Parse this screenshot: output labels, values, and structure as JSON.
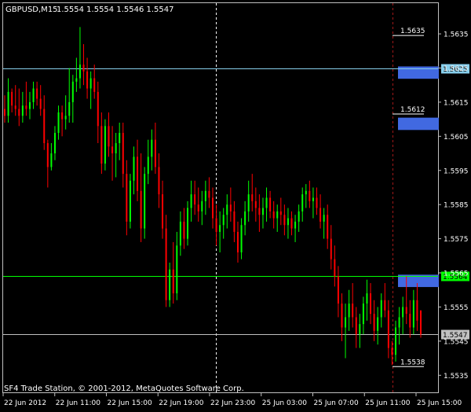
{
  "header": {
    "symbol_label": "GBPUSD,M15",
    "ohlc_label": "1.5554 1.5554 1.5546 1.5547"
  },
  "footer": {
    "copyright": "SF4 Trade Station, © 2001-2012, MetaQuotes Software Corp."
  },
  "chart_data": {
    "type": "candlestick",
    "symbol": "GBPUSD",
    "timeframe": "M15",
    "ohlc": {
      "open": 1.5554,
      "high": 1.5554,
      "low": 1.5546,
      "close": 1.5547
    },
    "ylim": [
      1.553,
      1.5644
    ],
    "y_ticks": [
      "1.5635",
      "1.5625",
      "1.5615",
      "1.5605",
      "1.5595",
      "1.5585",
      "1.5575",
      "1.5565",
      "1.5555",
      "1.5545",
      "1.5535"
    ],
    "x_ticks": [
      "22 Jun 2012",
      "22 Jun 11:00",
      "22 Jun 15:00",
      "22 Jun 19:00",
      "22 Jun 23:00",
      "25 Jun 03:00",
      "25 Jun 07:00",
      "25 Jun 11:00",
      "25 Jun 15:00"
    ],
    "horizontal_lines": [
      {
        "price": 1.5625,
        "label": "1.5625",
        "color": "#87CEEB"
      },
      {
        "price": 1.5564,
        "label": "1.5564",
        "color": "#00FF00"
      },
      {
        "price": 1.5547,
        "label": "1.5547",
        "color": "#C0C0C0"
      }
    ],
    "price_markers": [
      {
        "price": 1.5635,
        "label": "1.5635"
      },
      {
        "price": 1.5612,
        "label": "1.5612"
      },
      {
        "price": 1.5538,
        "label": "1.5538"
      }
    ],
    "zones": [
      {
        "top": 1.5625,
        "bottom": 1.5623
      },
      {
        "top": 1.561,
        "bottom": 1.5608
      },
      {
        "top": 1.5564,
        "bottom": 1.5562
      }
    ],
    "candles": [
      [
        1.5613,
        1.5617,
        1.5609,
        1.5611
      ],
      [
        1.5611,
        1.5622,
        1.5609,
        1.5618
      ],
      [
        1.5618,
        1.5619,
        1.5612,
        1.5614
      ],
      [
        1.5614,
        1.562,
        1.5611,
        1.5613
      ],
      [
        1.5613,
        1.5619,
        1.5608,
        1.5611
      ],
      [
        1.5611,
        1.5618,
        1.5609,
        1.5614
      ],
      [
        1.5614,
        1.5621,
        1.5611,
        1.5613
      ],
      [
        1.5613,
        1.5618,
        1.561,
        1.5615
      ],
      [
        1.5615,
        1.5621,
        1.5613,
        1.5619
      ],
      [
        1.5619,
        1.5621,
        1.5614,
        1.5616
      ],
      [
        1.5616,
        1.562,
        1.5611,
        1.5613
      ],
      [
        1.5613,
        1.5617,
        1.5601,
        1.5603
      ],
      [
        1.5603,
        1.5604,
        1.559,
        1.5596
      ],
      [
        1.5596,
        1.5603,
        1.5595,
        1.56
      ],
      [
        1.56,
        1.5608,
        1.5598,
        1.5606
      ],
      [
        1.5606,
        1.5614,
        1.5604,
        1.5612
      ],
      [
        1.5612,
        1.5614,
        1.5605,
        1.561
      ],
      [
        1.561,
        1.5617,
        1.5607,
        1.5611
      ],
      [
        1.5611,
        1.5625,
        1.5609,
        1.5615
      ],
      [
        1.5615,
        1.5623,
        1.5609,
        1.5621
      ],
      [
        1.5621,
        1.5628,
        1.5618,
        1.5622
      ],
      [
        1.5622,
        1.5637,
        1.5619,
        1.5626
      ],
      [
        1.5626,
        1.5632,
        1.562,
        1.5624
      ],
      [
        1.5624,
        1.5628,
        1.5616,
        1.5619
      ],
      [
        1.5619,
        1.5624,
        1.5613,
        1.5622
      ],
      [
        1.5622,
        1.5626,
        1.5616,
        1.5618
      ],
      [
        1.5618,
        1.5621,
        1.5603,
        1.5608
      ],
      [
        1.5608,
        1.5612,
        1.5594,
        1.5597
      ],
      [
        1.5597,
        1.561,
        1.5595,
        1.5608
      ],
      [
        1.5608,
        1.5612,
        1.5599,
        1.5602
      ],
      [
        1.5602,
        1.5608,
        1.5592,
        1.56
      ],
      [
        1.56,
        1.5606,
        1.5593,
        1.5603
      ],
      [
        1.5603,
        1.5609,
        1.5598,
        1.5606
      ],
      [
        1.5606,
        1.5609,
        1.559,
        1.5594
      ],
      [
        1.5594,
        1.5598,
        1.5576,
        1.558
      ],
      [
        1.558,
        1.5594,
        1.5578,
        1.5592
      ],
      [
        1.5592,
        1.5602,
        1.5588,
        1.5599
      ],
      [
        1.5599,
        1.5604,
        1.5586,
        1.5589
      ],
      [
        1.5589,
        1.56,
        1.5574,
        1.5578
      ],
      [
        1.5578,
        1.5596,
        1.5575,
        1.5594
      ],
      [
        1.5594,
        1.5604,
        1.5591,
        1.5599
      ],
      [
        1.5599,
        1.5607,
        1.5595,
        1.5604
      ],
      [
        1.5604,
        1.5609,
        1.5594,
        1.5596
      ],
      [
        1.5596,
        1.56,
        1.5584,
        1.5588
      ],
      [
        1.5588,
        1.5592,
        1.5575,
        1.5578
      ],
      [
        1.5578,
        1.5582,
        1.5555,
        1.5557
      ],
      [
        1.5557,
        1.5568,
        1.5555,
        1.5566
      ],
      [
        1.5566,
        1.5574,
        1.5556,
        1.5559
      ],
      [
        1.5559,
        1.5577,
        1.5557,
        1.5573
      ],
      [
        1.5573,
        1.5583,
        1.557,
        1.558
      ],
      [
        1.558,
        1.5584,
        1.5572,
        1.5575
      ],
      [
        1.5575,
        1.5586,
        1.5573,
        1.5584
      ],
      [
        1.5584,
        1.5592,
        1.558,
        1.5588
      ],
      [
        1.5588,
        1.5592,
        1.5582,
        1.5585
      ],
      [
        1.5585,
        1.559,
        1.558,
        1.5583
      ],
      [
        1.5583,
        1.5589,
        1.5579,
        1.5586
      ],
      [
        1.5586,
        1.5592,
        1.5582,
        1.5589
      ],
      [
        1.5589,
        1.5593,
        1.5584,
        1.5587
      ],
      [
        1.5587,
        1.559,
        1.5578,
        1.5581
      ],
      [
        1.5581,
        1.5585,
        1.5573,
        1.5577
      ],
      [
        1.5577,
        1.5583,
        1.5571,
        1.5579
      ],
      [
        1.5579,
        1.5584,
        1.5575,
        1.5582
      ],
      [
        1.5582,
        1.5588,
        1.5578,
        1.5585
      ],
      [
        1.5585,
        1.559,
        1.558,
        1.5583
      ],
      [
        1.5583,
        1.5586,
        1.5574,
        1.5577
      ],
      [
        1.5577,
        1.558,
        1.5568,
        1.5571
      ],
      [
        1.5571,
        1.5581,
        1.5569,
        1.5579
      ],
      [
        1.5579,
        1.5586,
        1.5576,
        1.5583
      ],
      [
        1.5583,
        1.5592,
        1.558,
        1.5588
      ],
      [
        1.5588,
        1.5594,
        1.5583,
        1.5586
      ],
      [
        1.5586,
        1.559,
        1.558,
        1.5584
      ],
      [
        1.5584,
        1.5588,
        1.5577,
        1.5582
      ],
      [
        1.5582,
        1.5587,
        1.5578,
        1.5584
      ],
      [
        1.5584,
        1.559,
        1.558,
        1.5587
      ],
      [
        1.5587,
        1.5589,
        1.5581,
        1.5583
      ],
      [
        1.5583,
        1.5586,
        1.5578,
        1.5581
      ],
      [
        1.5581,
        1.5585,
        1.5577,
        1.5583
      ],
      [
        1.5583,
        1.5587,
        1.5579,
        1.5582
      ],
      [
        1.5582,
        1.5585,
        1.5576,
        1.5579
      ],
      [
        1.5579,
        1.5584,
        1.5575,
        1.5581
      ],
      [
        1.5581,
        1.5583,
        1.5576,
        1.5578
      ],
      [
        1.5578,
        1.5582,
        1.5574,
        1.558
      ],
      [
        1.558,
        1.5585,
        1.5577,
        1.5583
      ],
      [
        1.5583,
        1.559,
        1.558,
        1.5588
      ],
      [
        1.5588,
        1.5591,
        1.5584,
        1.5589
      ],
      [
        1.5589,
        1.5592,
        1.5584,
        1.5586
      ],
      [
        1.5586,
        1.559,
        1.5581,
        1.5587
      ],
      [
        1.5587,
        1.559,
        1.5582,
        1.5584
      ],
      [
        1.5584,
        1.5588,
        1.5578,
        1.558
      ],
      [
        1.558,
        1.5584,
        1.5575,
        1.5582
      ],
      [
        1.5582,
        1.5585,
        1.5572,
        1.5575
      ],
      [
        1.5575,
        1.5579,
        1.5566,
        1.5569
      ],
      [
        1.5569,
        1.5573,
        1.5561,
        1.5564
      ],
      [
        1.5564,
        1.5567,
        1.5552,
        1.5556
      ],
      [
        1.5556,
        1.5559,
        1.5545,
        1.5549
      ],
      [
        1.5549,
        1.5556,
        1.554,
        1.5552
      ],
      [
        1.5552,
        1.556,
        1.5548,
        1.5556
      ],
      [
        1.5556,
        1.5562,
        1.5549,
        1.5552
      ],
      [
        1.5552,
        1.5555,
        1.5543,
        1.5547
      ],
      [
        1.5547,
        1.5553,
        1.5543,
        1.555
      ],
      [
        1.555,
        1.5558,
        1.5547,
        1.5556
      ],
      [
        1.5556,
        1.5563,
        1.5551,
        1.5559
      ],
      [
        1.5559,
        1.5562,
        1.555,
        1.5553
      ],
      [
        1.5553,
        1.5557,
        1.5545,
        1.5548
      ],
      [
        1.5548,
        1.5555,
        1.5544,
        1.5552
      ],
      [
        1.5552,
        1.5559,
        1.5549,
        1.5557
      ],
      [
        1.5557,
        1.5562,
        1.5552,
        1.5554
      ],
      [
        1.5554,
        1.5557,
        1.554,
        1.5543
      ],
      [
        1.5543,
        1.5545,
        1.5538,
        1.5541
      ],
      [
        1.5541,
        1.5551,
        1.5539,
        1.5549
      ],
      [
        1.5549,
        1.5555,
        1.5544,
        1.5552
      ],
      [
        1.5552,
        1.5558,
        1.5547,
        1.5555
      ],
      [
        1.5555,
        1.5564,
        1.555,
        1.5553
      ],
      [
        1.5553,
        1.5557,
        1.5546,
        1.5549
      ],
      [
        1.5549,
        1.556,
        1.5547,
        1.5557
      ],
      [
        1.5557,
        1.5562,
        1.5548,
        1.5551
      ],
      [
        1.5554,
        1.5554,
        1.5546,
        1.5547
      ]
    ]
  }
}
